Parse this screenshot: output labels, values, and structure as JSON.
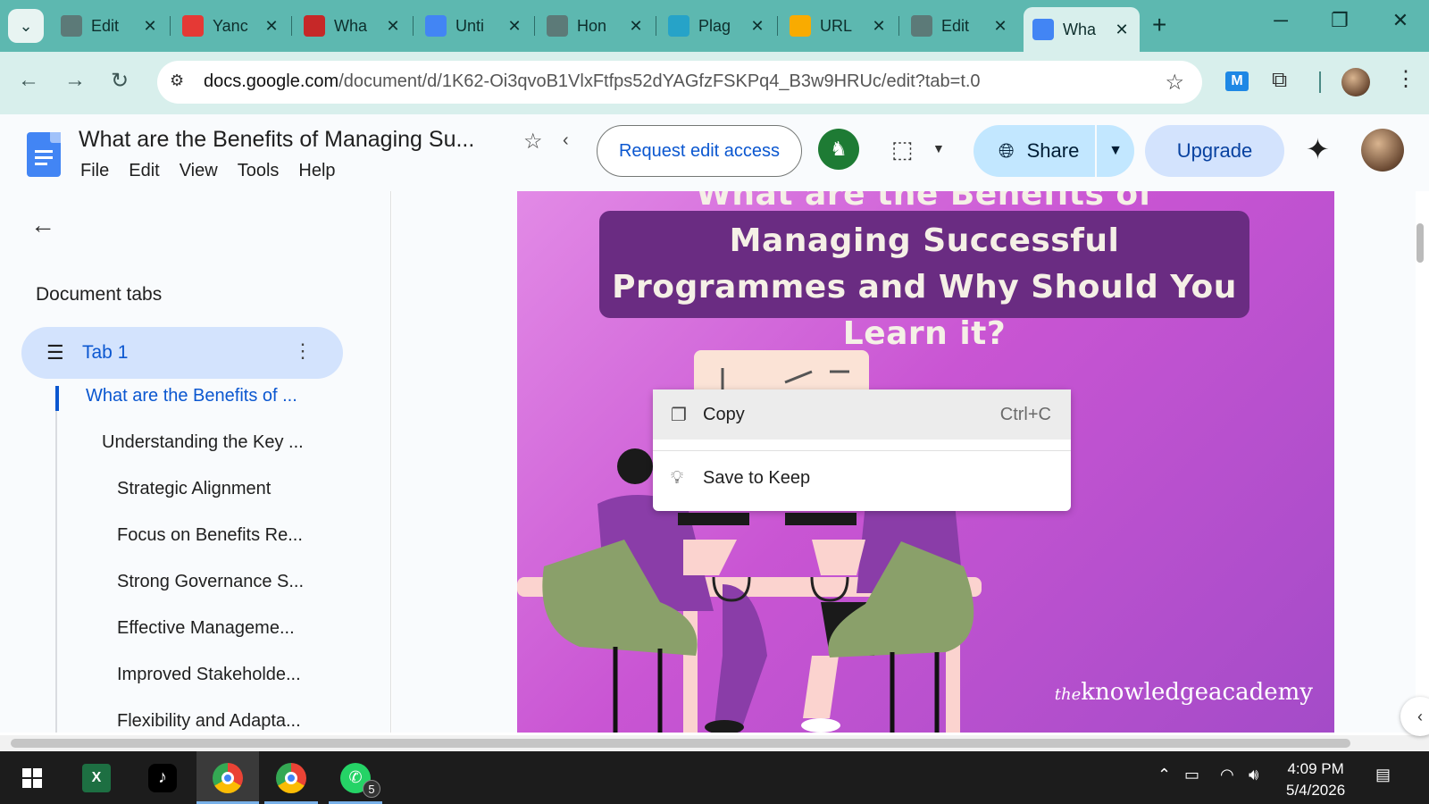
{
  "browser": {
    "tabs": [
      {
        "label": "Edit",
        "icon": "feather-icon",
        "color": "#5c7a78"
      },
      {
        "label": "Yanc",
        "icon": "yandex-icon",
        "color": "#e53935"
      },
      {
        "label": "Wha",
        "icon": "red-circle-icon",
        "color": "#c62828"
      },
      {
        "label": "Unti",
        "icon": "docs-icon",
        "color": "#4285f4"
      },
      {
        "label": "Hon",
        "icon": "feather-icon",
        "color": "#5c7a78"
      },
      {
        "label": "Plag",
        "icon": "c-icon",
        "color": "#26a3c8"
      },
      {
        "label": "URL",
        "icon": "analytics-icon",
        "color": "#f9ab00"
      },
      {
        "label": "Edit",
        "icon": "feather-icon",
        "color": "#5c7a78"
      },
      {
        "label": "Wha",
        "icon": "docs-icon",
        "color": "#4285f4"
      }
    ],
    "url_host": "docs.google.com",
    "url_path": "/document/d/1K62-Oi3qvoB1VlxFtfps52dYAGfzFSKPq4_B3w9HRUc/edit?tab=t.0"
  },
  "docs": {
    "title": "What are the Benefits of Managing Su...",
    "menu": [
      "File",
      "Edit",
      "View",
      "Tools",
      "Help"
    ],
    "request_edit": "Request edit access",
    "share": "Share",
    "upgrade": "Upgrade"
  },
  "sidebar": {
    "heading": "Document tabs",
    "tab_name": "Tab 1",
    "outline": [
      {
        "text": "What are the Benefits of ...",
        "level": 1,
        "active": true
      },
      {
        "text": "Understanding the Key ...",
        "level": 2
      },
      {
        "text": "Strategic Alignment",
        "level": 3
      },
      {
        "text": "Focus on Benefits Re...",
        "level": 3
      },
      {
        "text": "Strong Governance S...",
        "level": 3
      },
      {
        "text": "Effective Manageme...",
        "level": 3
      },
      {
        "text": "Improved Stakeholde...",
        "level": 3
      },
      {
        "text": "Flexibility and Adapta...",
        "level": 3
      }
    ]
  },
  "image": {
    "banner_line1": "What are the Benefits of Managing Successful",
    "banner_line2": "Programmes and Why Should You Learn it?",
    "watermark_the": "the",
    "watermark_brand": "knowledgeacademy"
  },
  "context_menu": {
    "copy": "Copy",
    "copy_shortcut": "Ctrl+C",
    "keep": "Save to Keep"
  },
  "taskbar": {
    "whatsapp_badge": "5",
    "time": "4:09 PM",
    "date": "5/4/2026"
  }
}
